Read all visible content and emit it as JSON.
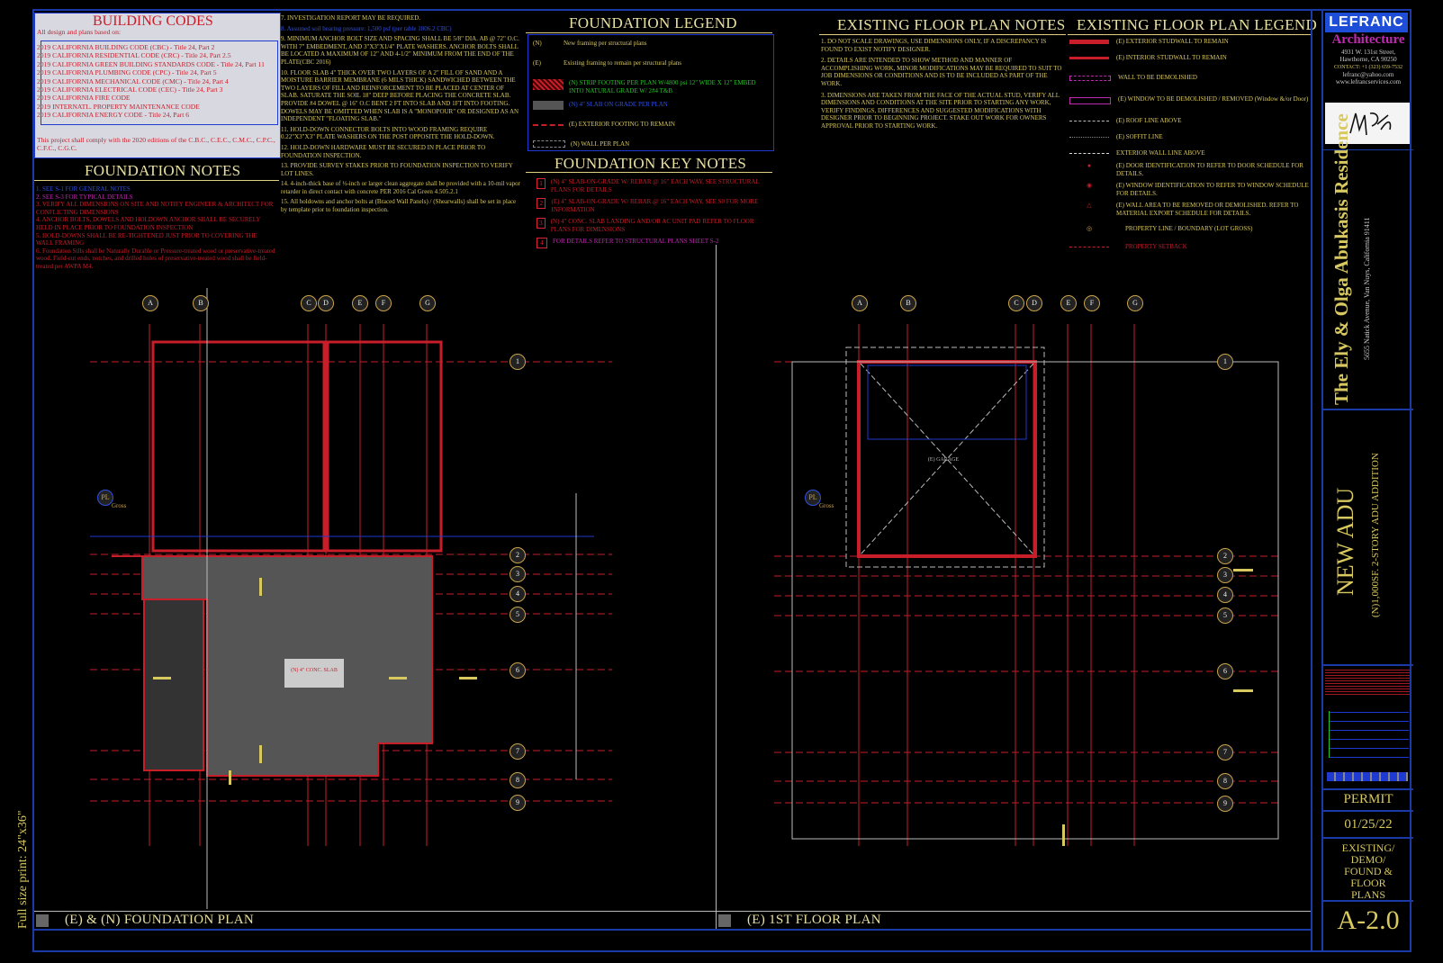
{
  "building_codes": {
    "title": "BUILDING  CODES",
    "intro": "All design and plans based on:",
    "items": [
      "2019 CALIFORNIA BUILDING CODE (CBC) - Title 24, Part 2",
      "2019 CALIFORNIA RESIDENTIAL CODE (CRC) - Title 24, Part 2.5",
      "2019 CALIFORNIA GREEN BUILDING STANDARDS CODE - Title 24, Part 11",
      "2019 CALIFORNIA PLUMBING CODE (CPC) - Title 24, Part 5",
      "2019 CALIFORNIA MECHANICAL CODE (CMC) - Title 24, Part 4",
      "2019 CALIFORNIA ELECTRICAL CODE (CEC) - Title 24, Part 3",
      "2019 CALIFORNIA FIRE CODE",
      "2019 INTERNATL. PROPERTY MAINTENANCE CODE",
      "2019 CALIFORNIA ENERGY CODE - Title 24, Part 6"
    ],
    "comply": "This project shall comply with the 2020 editions of the C.B.C., C.E.C., C.M.C., C.P.C., C.F.C., C.G.C."
  },
  "foundation_notes": {
    "title": "FOUNDATION NOTES",
    "items": [
      "1.    SEE S-1 FOR GENERAL NOTES",
      "2.    SEE S-3 FOR TYPICAL DETAILS",
      "3.    VERIFY ALL DIMENSIONS ON SITE AND NOTIFY ENGINEER & ARCHITECT FOR CONFLICTING DIMENSIONS",
      "4.    ANCHOR BOLTS, DOWELS AND HOLDOWN ANCHOR SHALL BE SECURELY HELD IN PLACE PRIOR TO FOUNDATION INSPECTION",
      "5.    HOLD-DOWNS SHALL BE RE-TIGHTENED JUST PRIOR TO COVERING THE WALL FRAMING",
      "6.    Foundation Sills shall be Naturally Durable or  Pressure-treated wood or preservative-treated wood. Field-cut ends, notches, and drilled holes of preservative-treated wood shall be field-treated per AWPA M4."
    ],
    "col2": [
      "7.    INVESTIGATION REPORT MAY BE REQUIRED.",
      "8.    Assumed soil bearing pressure: 1,500 psf (per table 1806.2 CBC)",
      "9.    MINIMUM ANCHOR BOLT SIZE AND SPACING SHALL BE 5/8\" DIA. AB @ 72\" O.C. WITH 7\" EMBEDMENT, AND 3\"X3\"X1/4\" PLATE WASHERS. ANCHOR BOLTS SHALL BE LOCATED A MAXIMUM OF 12\" AND 4-1/2\" MINIMUM FROM THE END OF THE PLATE(CBC 2016)",
      "10.    FLOOR SLAB 4\" THICK OVER TWO LAYERS OF A 2\" FILL OF SAND AND A MOISTURE BARRIER MEMBRANE (6 MILS THICK) SANDWICHED BETWEEN THE TWO LAYERS OF FILL AND REINFORCEMENT TO BE PLACED AT CENTER OF SLAB. SATURATE THE SOIL 18\" DEEP BEFORE PLACING THE CONCRETE SLAB. PROVIDE #4 DOWEL @ 16\" O.C BENT 2 FT INTO SLAB AND 1FT INTO FOOTING. DOWELS MAY BE OMITTED WHEN SLAB IS A \"MONOPOUR\" OR DESIGNED AS AN INDEPENDENT \"FLOATING SLAB.\"",
      "11.    HOLD-DOWN CONNECTOR BOLTS INTO WOOD FRAMING REQUIRE 0.22\"X3\"X3\" PLATE WASHERS ON THE POST OPPOSITE THE HOLD-DOWN.",
      "12.    HOLD-DOWN HARDWARE MUST BE SECURED IN PLACE PRIOR TO FOUNDATION INSPECTION.",
      "13.    PROVIDE SURVEY STAKES PRIOR TO FOUNDATION INSPECTION TO VERIFY LOT LINES.",
      "14.    4-inch-thick base of ½-inch or larger clean aggregate shall be provided with a 10-mil vapor retarder in direct contact with concrete PER 2016 Cal Green 4.505.2.1",
      "15.    All holdowns and anchor bolts at (Braced Wall Panels) / (Shearwalls) shall be set in place by template prior to foundation inspection."
    ]
  },
  "foundation_legend": {
    "title": "FOUNDATION LEGEND",
    "items": [
      {
        "tag": "(N)",
        "text": "New framing per structural plans"
      },
      {
        "tag": "(E)",
        "text": "Existing framing to remain per structural plans"
      },
      {
        "tag": "",
        "text": "(N) STRIP FOOTING PER PLAN W/4800 psi 12\" WIDE X 12\" EMBED INTO NATURAL GRADE W/ 2#4 T&B"
      },
      {
        "tag": "",
        "text": "(N) 4\" SLAB ON GRADE PER PLAN"
      },
      {
        "tag": "",
        "text": "(E) EXTERIOR FOOTING TO REMAIN"
      },
      {
        "tag": "",
        "text": "(N) WALL PER PLAN"
      }
    ]
  },
  "foundation_key_notes": {
    "title": "FOUNDATION  KEY NOTES",
    "items": [
      {
        "key": "1",
        "text": "(N) 4\" SLAB-ON-GRADE W/ REBAR @ 16\" EACH WAY, SEE STRUCTURAL PLANS FOR DETAILS"
      },
      {
        "key": "2",
        "text": "(E) 4\" SLAB-ON-GRADE W/ REBAR @ 16\" EACH WAY, SEE S0 FOR MORE INFORMATION"
      },
      {
        "key": "3",
        "text": "(N) 4\" CONC. SLAB LANDING AND/OR AC UNIT PAD REFER TO FLOOR PLANS FOR DIMENSIONS"
      },
      {
        "key": "4",
        "text": "FOR DETAILS REFER TO STRUCTURAL PLANS SHEET S-2"
      }
    ]
  },
  "existing_notes": {
    "title": "EXISTING FLOOR PLAN NOTES",
    "items": [
      "1.     DO NOT SCALE DRAWINGS, USE DIMENSIONS ONLY, IF A DISCREPANCY IS FOUND TO EXIST NOTIFY DESIGNER.",
      "2.     DETAILS ARE INTENDED TO SHOW METHOD AND MANNER OF ACCOMPLISHING WORK, MINOR MODIFICATIONS MAY BE REQUIRED TO SUIT TO JOB DIMENSIONS OR CONDITIONS AND IS TO BE INCLUDED AS PART OF THE WORK.",
      "3.     DIMENSIONS ARE TAKEN FROM THE FACE OF THE ACTUAL STUD, VERIFY ALL DIMENSIONS AND CONDITIONS AT THE SITE PRIOR TO STARTING ANY WORK, VERIFY FINDINGS, DIFFERENCES AND SUGGESTED MODIFICATIONS WITH DESIGNER PRIOR TO BEGINNING PROJECT. STAKE OUT WORK FOR OWNERS APPROVAL PRIOR TO STARTING WORK."
    ]
  },
  "existing_legend": {
    "title": "EXISTING FLOOR PLAN LEGEND",
    "items": [
      "(E) EXTERIOR STUDWALL TO REMAIN",
      "(E) INTERIOR STUDWALL TO REMAIN",
      "WALL TO BE DEMOLISHED",
      "(E) WINDOW TO BE DEMOLISHED / REMOVED (Window &/or Door)",
      "(E) ROOF LINE ABOVE",
      "(E) SOFFIT LINE",
      "EXTERIOR WALL LINE ABOVE",
      "(E) DOOR IDENTIFICATION TO REFER TO DOOR SCHEDULE FOR DETAILS.",
      "(E) WINDOW IDENTIFICATION TO REFER TO WINDOW SCHEDULE FOR DETAILS.",
      "(E) WALL AREA TO BE REMOVED OR DEMOLISHED. REFER TO MATERIAL EXPORT SCHEDULE FOR DETAILS.",
      "PROPERTY LINE / BOUNDARY (LOT GROSS)",
      "PROPERTY SETBACK"
    ]
  },
  "plans": {
    "left_title": "(E) & (N) FOUNDATION PLAN",
    "right_title": "(E) 1ST FLOOR PLAN",
    "grid_letters": [
      "A",
      "B",
      "C",
      "D",
      "E",
      "F",
      "G"
    ],
    "grid_numbers": [
      "1",
      "2",
      "3",
      "4",
      "5",
      "6",
      "7",
      "8",
      "9"
    ],
    "pl_label": "PL",
    "gross_label": "Gross",
    "garage_label": "(E) GARAGE",
    "slab_label": "(N) 4\" CONC. SLAB"
  },
  "side_label": "Full size print: 24\"x36\"",
  "title_block": {
    "logo": "LEFRANC",
    "firm": "Architecture",
    "address1": "4931 W. 131st Street,",
    "address2": "Hawthorne, CA 90250",
    "phone": "CONTACT: +1 (323) 659-7532",
    "email": "lefranc@yahoo.com",
    "web": "www.lefrancservices.com",
    "project": "The Ely & Olga Abukasis Residence",
    "project_address": "5655 Natick Avenue, Van Nuys, California 91411",
    "adu": "NEW ADU",
    "adu_sub": "(N)1,000SF. 2-STORY ADU ADDITION",
    "status": "PERMIT",
    "date": "01/25/22",
    "sheet_title": "EXISTING/ DEMO/ FOUND & FLOOR PLANS",
    "sheet_number": "A-2.0"
  },
  "colors": {
    "red": "#c81e2a",
    "yellow": "#d8c860",
    "green": "#29c22b",
    "blue": "#1e3ad0",
    "magenta": "#c02ab0"
  }
}
